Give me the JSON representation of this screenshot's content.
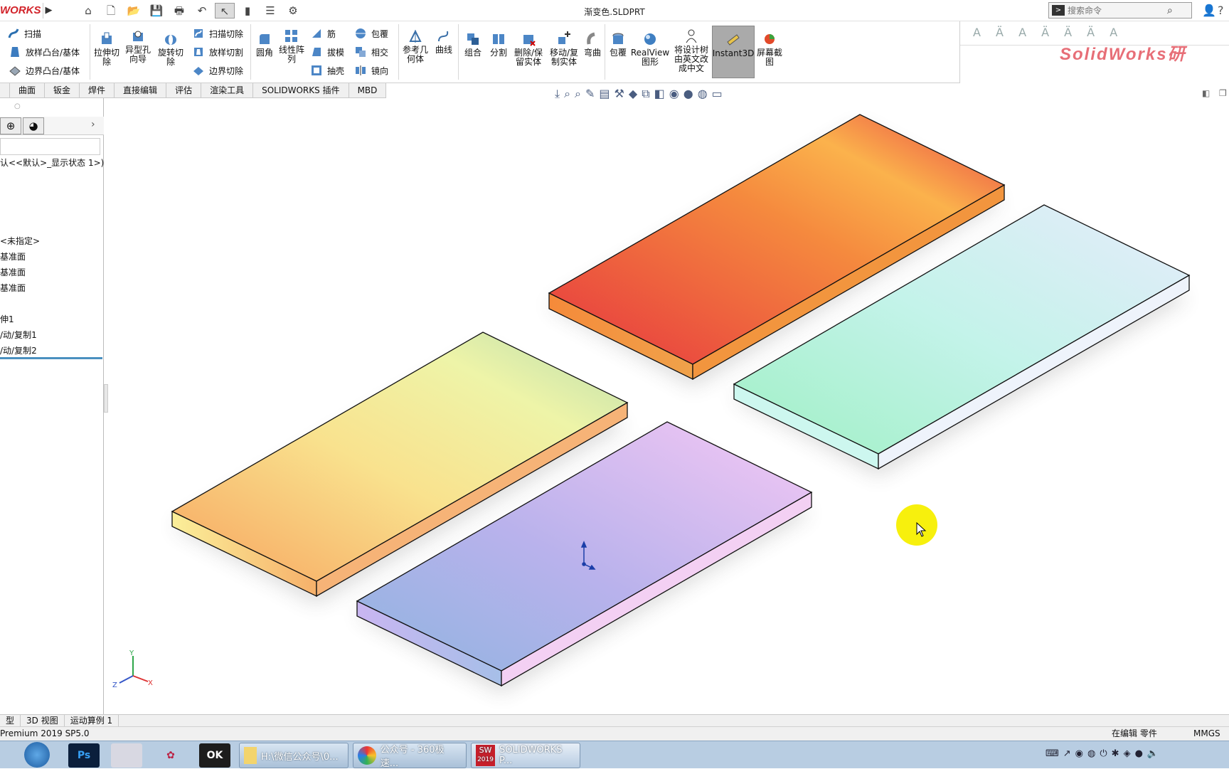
{
  "app": {
    "brand": "WORKS",
    "document_title": "渐变色.SLDPRT",
    "search_placeholder": "搜索命令",
    "watermark": "SolidWorks研"
  },
  "ribbon": {
    "sweep": "扫描",
    "loft_boss": "放样凸台/基体",
    "boundary_boss": "边界凸台/基体",
    "extrude_cut": "拉伸切除",
    "hole_wizard": "异型孔向导",
    "revolve_cut": "旋转切除",
    "swept_cut": "扫描切除",
    "lofted_cut": "放样切割",
    "boundary_cut": "边界切除",
    "fillet": "圆角",
    "linear_pattern": "线性阵列",
    "rib": "筋",
    "draft": "拔模",
    "shell": "抽壳",
    "wrap": "包覆",
    "intersect": "相交",
    "mirror": "镜向",
    "reference_geometry": "参考几何体",
    "curves": "曲线",
    "combine": "组合",
    "split": "分割",
    "delete_keep_body": "删除/保留实体",
    "move_copy_body": "移动/复制实体",
    "flex": "弯曲",
    "wrap2": "包覆",
    "realview": "RealView图形",
    "translate_tree": "将设计树由英文改成中文",
    "instant3d": "Instant3D",
    "screen_capture": "屏幕截图"
  },
  "tabs": [
    "曲面",
    "钣金",
    "焊件",
    "直接编辑",
    "评估",
    "渲染工具",
    "SOLIDWORKS 插件",
    "MBD"
  ],
  "tree": {
    "config": "认<<默认>_显示状态 1>)",
    "material": "<未指定>",
    "plane1": "基准面",
    "plane2": "基准面",
    "plane3": "基准面",
    "feature1": "伸1",
    "feature2": "/动/复制1",
    "feature3": "/动/复制2"
  },
  "bottom_tabs": [
    "型",
    "3D 视图",
    "运动算例 1"
  ],
  "status": {
    "version": "Premium 2019 SP5.0",
    "mode": "在编辑 零件",
    "units": "MMGS"
  },
  "taskbar": {
    "ps_label": "Ps",
    "ok_label": "OK",
    "sw_label": "SW",
    "sw_year": "2019",
    "explorer": "H:\\微信公众号\\0...",
    "browser": "公众号 - 360极速...",
    "solidworks": "SOLIDWORKS P..."
  },
  "triad": {
    "x": "X",
    "y": "Y",
    "z": "Z"
  },
  "colors": {
    "accent": "#d2232a",
    "instant3d_active": "#aaaaaa"
  }
}
